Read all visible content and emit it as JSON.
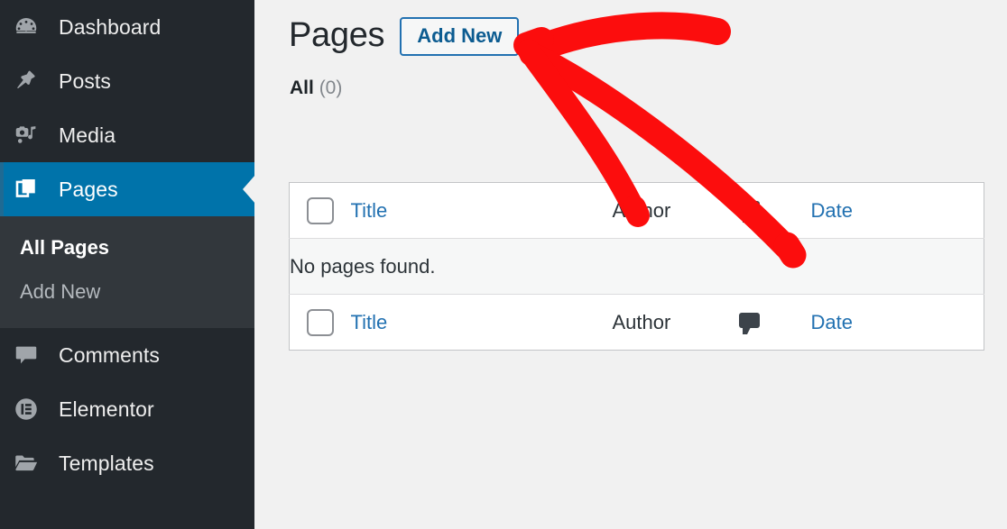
{
  "sidebar": {
    "items": [
      {
        "label": "Dashboard",
        "icon": "dashboard-gauge-icon",
        "active": false
      },
      {
        "label": "Posts",
        "icon": "pushpin-icon",
        "active": false
      },
      {
        "label": "Media",
        "icon": "camera-music-icon",
        "active": false
      },
      {
        "label": "Pages",
        "icon": "pages-stack-icon",
        "active": true
      },
      {
        "label": "Comments",
        "icon": "comment-bubble-icon",
        "active": false
      },
      {
        "label": "Elementor",
        "icon": "elementor-circle-icon",
        "active": false
      },
      {
        "label": "Templates",
        "icon": "open-folder-icon",
        "active": false
      }
    ],
    "submenu": [
      {
        "label": "All Pages",
        "current": true
      },
      {
        "label": "Add New",
        "current": false
      }
    ]
  },
  "header": {
    "title": "Pages",
    "add_new_label": "Add New"
  },
  "filters": {
    "all_label": "All",
    "all_count": "(0)"
  },
  "table": {
    "columns": {
      "title": "Title",
      "author": "Author",
      "comments_icon": "comment-bubble-icon",
      "date": "Date"
    },
    "empty_message": "No pages found."
  },
  "annotation": {
    "type": "hand-drawn-arrow",
    "color": "#fc0d0d",
    "description": "red arrow pointing up-left toward the Add New button"
  },
  "colors": {
    "sidebar_bg": "#23282d",
    "submenu_bg": "#32373c",
    "active_blue": "#0073aa",
    "link_blue": "#2271b1",
    "page_bg": "#f1f1f1",
    "annotation_red": "#fc0d0d"
  }
}
